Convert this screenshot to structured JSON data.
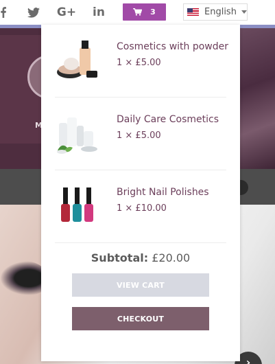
{
  "topbar": {
    "social": [
      {
        "name": "facebook-icon"
      },
      {
        "name": "twitter-icon"
      },
      {
        "name": "google-plus-icon",
        "label": "G+"
      },
      {
        "name": "linkedin-icon",
        "label": "in"
      }
    ],
    "cart_count": "3",
    "language": "English"
  },
  "background": {
    "hero_text": "M"
  },
  "cart": {
    "items": [
      {
        "name": "Cosmetics with powder",
        "qty_price": "1 × £5.00"
      },
      {
        "name": "Daily Care Cosmetics",
        "qty_price": "1 × £5.00"
      },
      {
        "name": "Bright Nail Polishes",
        "qty_price": "1 × £10.00"
      }
    ],
    "subtotal_label": "Subtotal:",
    "subtotal_value": "£20.00",
    "view_cart_label": "VIEW CART",
    "checkout_label": "CHECKOUT"
  },
  "colors": {
    "cart_button": "#a14aa7",
    "item_text": "#6b3e5a",
    "checkout_button": "#7d5f6c",
    "view_cart_button": "#d7d9e1"
  }
}
